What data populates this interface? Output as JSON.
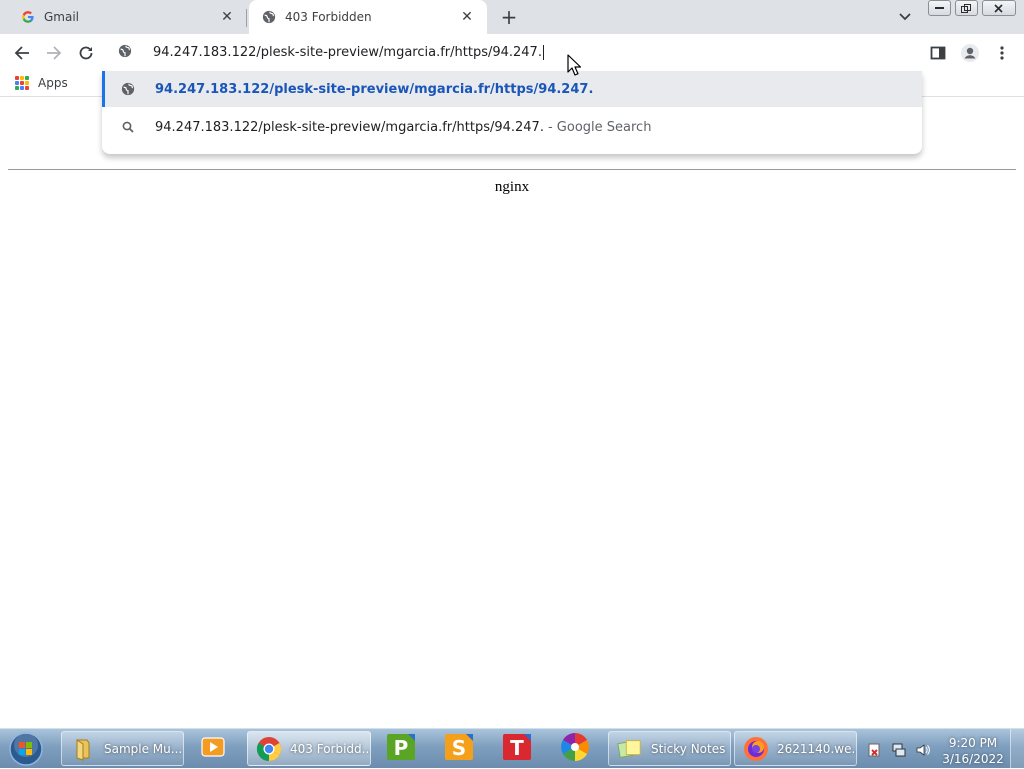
{
  "browser": {
    "tabs": [
      {
        "title": "Gmail",
        "favicon": "google-g-icon",
        "active": false
      },
      {
        "title": "403 Forbidden",
        "favicon": "globe-icon",
        "active": true
      }
    ],
    "omnibox": {
      "value": "94.247.183.122/plesk-site-preview/mgarcia.fr/https/94.247."
    },
    "bookmarks": {
      "apps_label": "Apps"
    },
    "suggestions": [
      {
        "icon": "globe-icon",
        "text": "94.247.183.122/plesk-site-preview/mgarcia.fr/https/94.247.",
        "suffix": ""
      },
      {
        "icon": "search-icon",
        "text": "94.247.183.122/plesk-site-preview/mgarcia.fr/https/94.247.",
        "suffix": "- Google Search"
      }
    ],
    "accent_color": "#1a73e8"
  },
  "page": {
    "server_text": "nginx"
  },
  "taskbar": {
    "items": [
      {
        "label": "Sample Mu...",
        "icon": "folder-icon"
      },
      {
        "label": "",
        "icon": "media-player-icon"
      },
      {
        "label": "403 Forbidd...",
        "icon": "chrome-icon"
      },
      {
        "label": "",
        "icon": "publisher-icon"
      },
      {
        "label": "",
        "icon": "sheets-icon"
      },
      {
        "label": "",
        "icon": "text-editor-icon"
      },
      {
        "label": "",
        "icon": "pinwheel-icon"
      },
      {
        "label": "Sticky Notes",
        "icon": "sticky-notes-icon"
      },
      {
        "label": "2621140.we...",
        "icon": "firefox-icon"
      }
    ],
    "clock": {
      "time": "9:20 PM",
      "date": "3/16/2022"
    }
  }
}
